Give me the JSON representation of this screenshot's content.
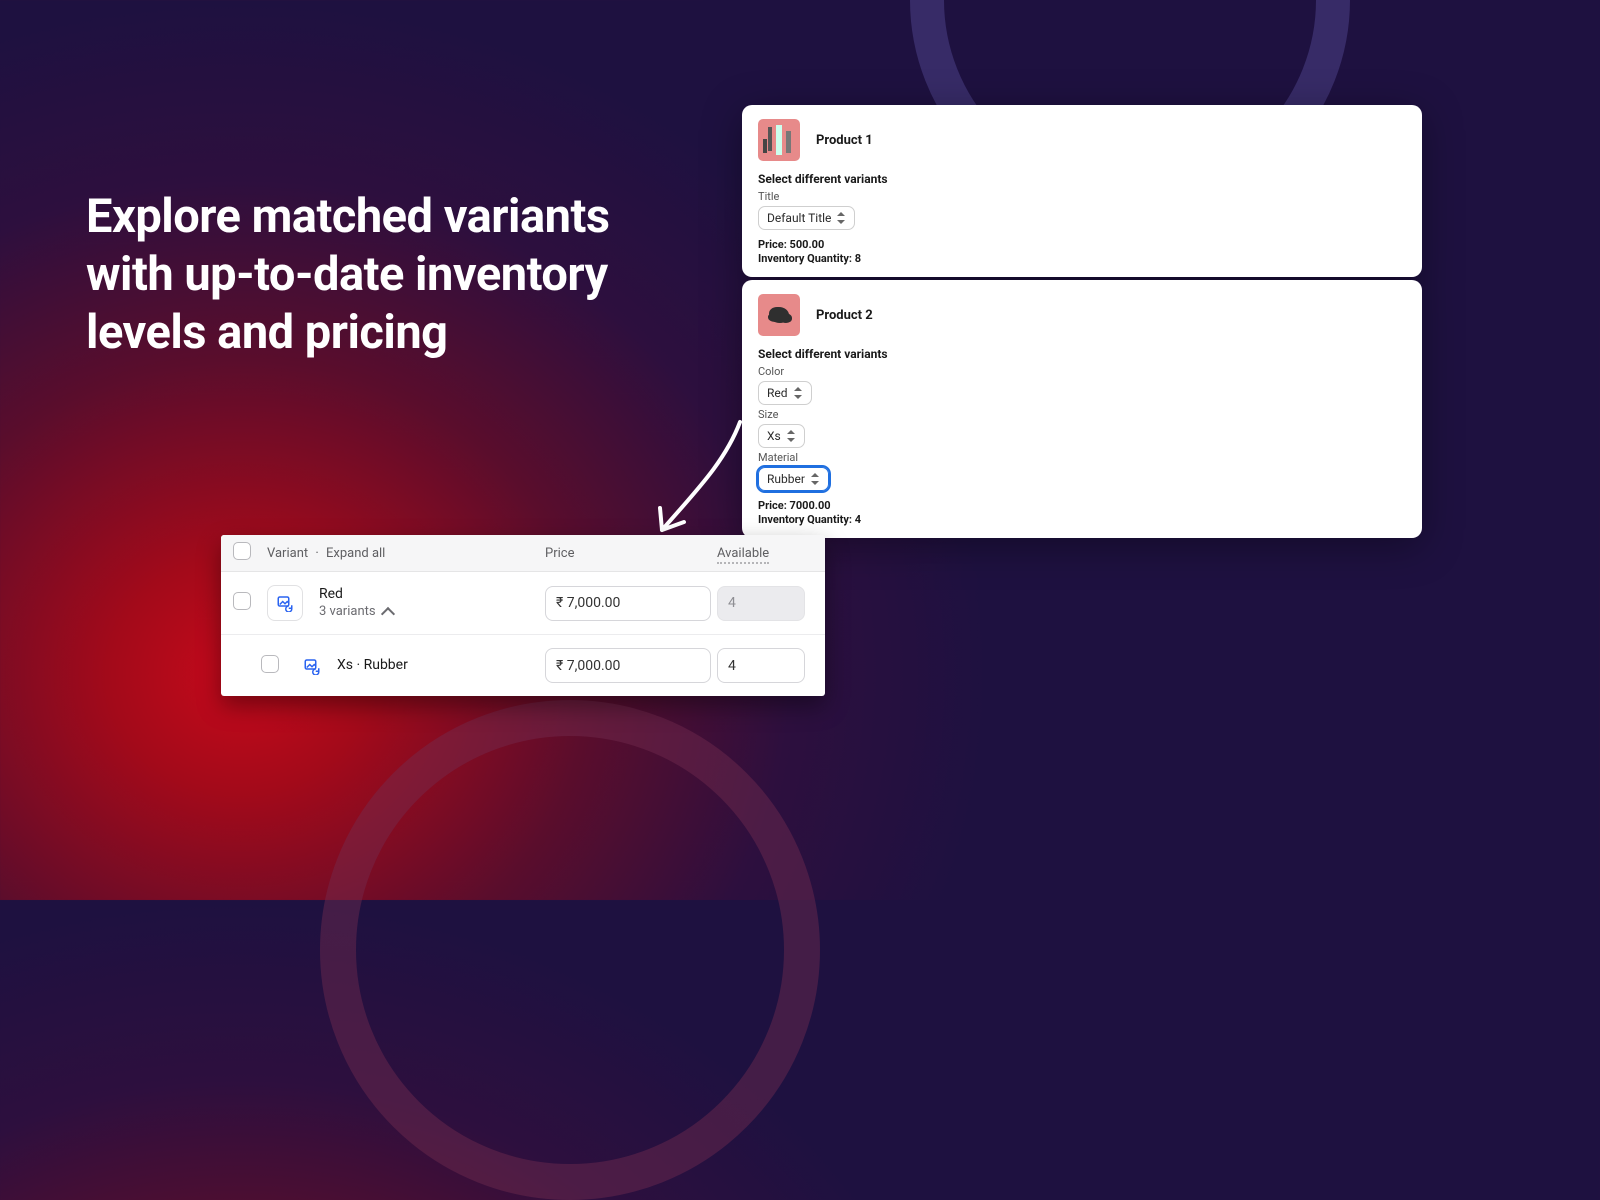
{
  "headline": "Explore matched variants with up-to-date inventory levels and pricing",
  "product1": {
    "name": "Product 1",
    "select_label": "Select different variants",
    "title_label": "Title",
    "title_value": "Default Title",
    "price_line": "Price: 500.00",
    "inv_line": "Inventory Quantity: 8"
  },
  "product2": {
    "name": "Product 2",
    "select_label": "Select different variants",
    "color_label": "Color",
    "color_value": "Red",
    "size_label": "Size",
    "size_value": "Xs",
    "material_label": "Material",
    "material_value": "Rubber",
    "price_line": "Price: 7000.00",
    "inv_line": "Inventory Quantity: 4"
  },
  "table": {
    "variant_header": "Variant",
    "expand_all": "Expand all",
    "price_header": "Price",
    "available_header": "Available",
    "row1": {
      "name": "Red",
      "sub": "3 variants",
      "price": "₹ 7,000.00",
      "available": "4"
    },
    "row2": {
      "name": "Xs · Rubber",
      "price": "₹ 7,000.00",
      "available": "4"
    }
  }
}
